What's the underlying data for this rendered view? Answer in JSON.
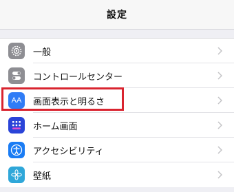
{
  "nav": {
    "title": "設定"
  },
  "settings": {
    "items": [
      {
        "label": "一般",
        "icon": "gear-icon",
        "color": "#8e8e93"
      },
      {
        "label": "コントロールセンター",
        "icon": "toggles-icon",
        "color": "#8e8e93"
      },
      {
        "label": "画面表示と明るさ",
        "icon": "text-size-icon",
        "color": "#2f7cf6"
      },
      {
        "label": "ホーム画面",
        "icon": "app-grid-icon",
        "color": "#2a44d8"
      },
      {
        "label": "アクセシビリティ",
        "icon": "accessibility-icon",
        "color": "#1a7cf4"
      },
      {
        "label": "壁紙",
        "icon": "flower-icon",
        "color": "#2fa7d9"
      }
    ]
  },
  "icon_text": {
    "display": "AA"
  },
  "highlight_color": "#d9242f"
}
